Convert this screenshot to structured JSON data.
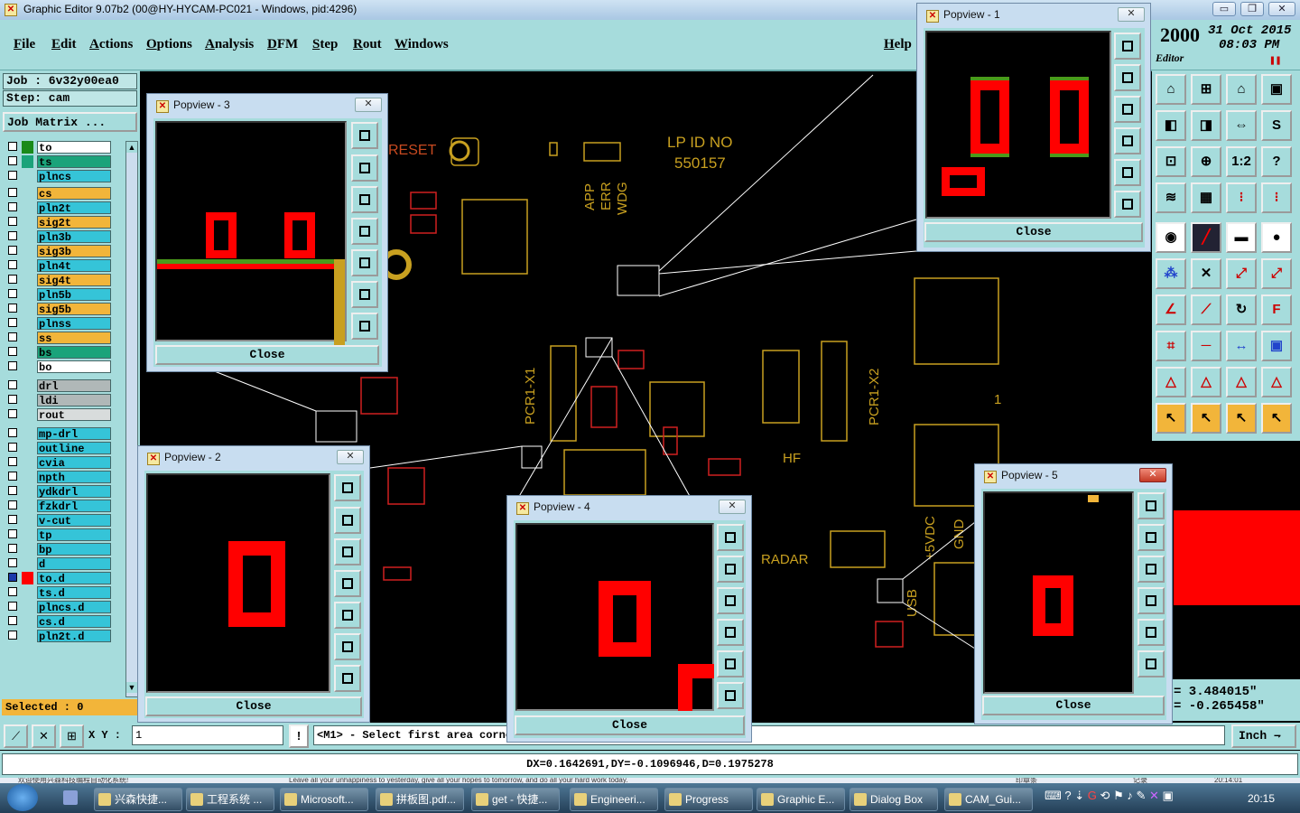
{
  "window": {
    "title": "Graphic Editor 9.07b2 (00@HY-HYCAM-PC021 - Windows, pid:4296)"
  },
  "menu": [
    "File",
    "Edit",
    "Actions",
    "Options",
    "Analysis",
    "DFM",
    "Step",
    "Rout",
    "Windows"
  ],
  "help_label": "Help",
  "header": {
    "year": "2000",
    "date": "31 Oct 2015",
    "time": "08:03 PM",
    "editor": "Editor"
  },
  "job": {
    "job_label": "Job : 6v32y00ea0",
    "step_label": "Step: cam",
    "matrix_button": "Job Matrix ..."
  },
  "layers": [
    {
      "name": "to",
      "color": "#ffffff",
      "swatch": "#1a8a1a"
    },
    {
      "name": "ts",
      "color": "#1aa37a",
      "swatch": "#1aa37a"
    },
    {
      "name": "plncs",
      "color": "#35c4d8",
      "swatch": ""
    },
    {
      "name": "cs",
      "color": "#f2b53a",
      "swatch": ""
    },
    {
      "name": "pln2t",
      "color": "#35c4d8",
      "swatch": ""
    },
    {
      "name": "sig2t",
      "color": "#f2b53a",
      "swatch": ""
    },
    {
      "name": "pln3b",
      "color": "#35c4d8",
      "swatch": ""
    },
    {
      "name": "sig3b",
      "color": "#f2b53a",
      "swatch": ""
    },
    {
      "name": "pln4t",
      "color": "#35c4d8",
      "swatch": ""
    },
    {
      "name": "sig4t",
      "color": "#f2b53a",
      "swatch": ""
    },
    {
      "name": "pln5b",
      "color": "#35c4d8",
      "swatch": ""
    },
    {
      "name": "sig5b",
      "color": "#f2b53a",
      "swatch": ""
    },
    {
      "name": "plnss",
      "color": "#35c4d8",
      "swatch": ""
    },
    {
      "name": "ss",
      "color": "#f2b53a",
      "swatch": ""
    },
    {
      "name": "bs",
      "color": "#1aa37a",
      "swatch": ""
    },
    {
      "name": "bo",
      "color": "#ffffff",
      "swatch": ""
    },
    {
      "name": "drl",
      "color": "#b0b8b8",
      "swatch": ""
    },
    {
      "name": "ldi",
      "color": "#b0b8b8",
      "swatch": ""
    },
    {
      "name": "rout",
      "color": "#d8dcdc",
      "swatch": ""
    },
    {
      "name": "mp-drl",
      "color": "#35c4d8",
      "swatch": ""
    },
    {
      "name": "outline",
      "color": "#35c4d8",
      "swatch": ""
    },
    {
      "name": "cvia",
      "color": "#35c4d8",
      "swatch": ""
    },
    {
      "name": "npth",
      "color": "#35c4d8",
      "swatch": ""
    },
    {
      "name": "ydkdrl",
      "color": "#35c4d8",
      "swatch": ""
    },
    {
      "name": "fzkdrl",
      "color": "#35c4d8",
      "swatch": ""
    },
    {
      "name": "v-cut",
      "color": "#35c4d8",
      "swatch": ""
    },
    {
      "name": "tp",
      "color": "#35c4d8",
      "swatch": ""
    },
    {
      "name": "bp",
      "color": "#35c4d8",
      "swatch": ""
    },
    {
      "name": "d",
      "color": "#35c4d8",
      "swatch": ""
    },
    {
      "name": "to.d",
      "color": "#35c4d8",
      "swatch": "#ff0000"
    },
    {
      "name": "ts.d",
      "color": "#35c4d8",
      "swatch": ""
    },
    {
      "name": "plncs.d",
      "color": "#35c4d8",
      "swatch": ""
    },
    {
      "name": "cs.d",
      "color": "#35c4d8",
      "swatch": ""
    },
    {
      "name": "pln2t.d",
      "color": "#35c4d8",
      "swatch": ""
    }
  ],
  "selected_label": "Selected : 0",
  "xy_label": "X Y :",
  "xy_value": "1",
  "prompt": "<M1> - Select first area corne",
  "units": "Inch",
  "dxdy": "DX=0.1642691,DY=-0.1096946,D=0.1975278",
  "coords": {
    "x": "= 3.484015\"",
    "y": "= -0.265458\""
  },
  "pcb_text": {
    "lp_id": "LP ID NO",
    "lp_num": "550157",
    "reset": "RESET",
    "app": "APP",
    "err": "ERR",
    "wdg": "WDG",
    "pcr1x1": "PCR1-X1",
    "pcr1x2": "PCR1-X2",
    "hf": "HF",
    "radar": "RADAR",
    "vdc": "+5VDC",
    "gnd": "GND",
    "usb": "USB",
    "one": "1"
  },
  "popups": [
    {
      "title": "Popview - 1",
      "close": "Close"
    },
    {
      "title": "Popview - 2",
      "close": "Close"
    },
    {
      "title": "Popview - 3",
      "close": "Close"
    },
    {
      "title": "Popview - 4",
      "close": "Close"
    },
    {
      "title": "Popview - 5",
      "close": "Close"
    }
  ],
  "statusline": {
    "left": "欢迎使用兴森科技编程自动化系统!",
    "center": "Leave all your unhappiness to yesterday, give all your hopes to tomorrow, and do all your hard work today.",
    "right": "印章条",
    "far": "记录",
    "time2": "20:14:01"
  },
  "taskbar": {
    "items": [
      "兴森快捷...",
      "工程系统 ...",
      "Microsoft...",
      "拼板图.pdf...",
      "get - 快捷...",
      "Engineeri...",
      "Progress",
      "Graphic E...",
      "Dialog Box",
      "CAM_Gui..."
    ],
    "clock": "20:15"
  }
}
